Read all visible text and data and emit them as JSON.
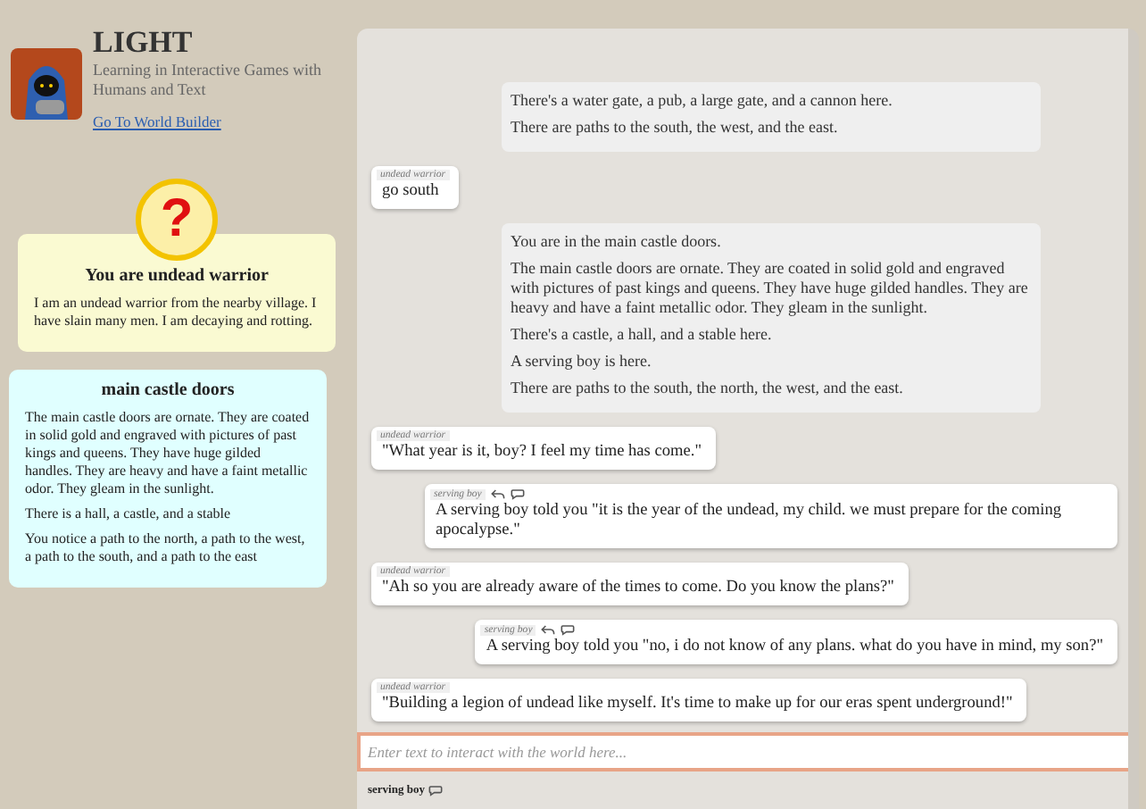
{
  "app": {
    "title": "LIGHT",
    "subtitle": "Learning in Interactive Games with Humans and Text",
    "link": "Go To World Builder"
  },
  "character": {
    "badge": "?",
    "title": "You are undead warrior",
    "description": "I am an undead warrior from the nearby village. I have slain many men. I am decaying and rotting."
  },
  "location": {
    "title": "main castle doors",
    "paragraphs": [
      "The main castle doors are ornate. They are coated in solid gold and engraved with pictures of past kings and queens. They have huge gilded handles. They are heavy and have a faint metallic odor. They gleam in the sunlight.",
      "There is a hall, a castle, and a stable",
      "You notice a path to the north, a path to the west, a path to the south, and a path to the east"
    ]
  },
  "messages": [
    {
      "kind": "room",
      "paragraphs": [
        "There's a water gate, a pub, a large gate, and a cannon here.",
        "There are paths to the south, the west, and the east."
      ]
    },
    {
      "kind": "self",
      "author": "undead warrior",
      "text": "go south"
    },
    {
      "kind": "room",
      "paragraphs": [
        "You are in the main castle doors.",
        "The main castle doors are ornate. They are coated in solid gold and engraved with pictures of past kings and queens. They have huge gilded handles. They are heavy and have a faint metallic odor. They gleam in the sunlight.",
        "There's a castle, a hall, and a stable here.",
        "A serving boy is here.",
        "There are paths to the south, the north, the west, and the east."
      ]
    },
    {
      "kind": "self",
      "author": "undead warrior",
      "text": "\"What year is it, boy? I feel my time has come.\""
    },
    {
      "kind": "other",
      "author": "serving boy",
      "text": "A serving boy told you \"it is the year of the undead, my child. we must prepare for the coming apocalypse.\""
    },
    {
      "kind": "self",
      "author": "undead warrior",
      "text": "\"Ah so you are already aware of the times to come. Do you know the plans?\""
    },
    {
      "kind": "other",
      "author": "serving boy",
      "text": "A serving boy told you \"no, i do not know of any plans. what do you have in mind, my son?\""
    },
    {
      "kind": "self",
      "author": "undead warrior",
      "text": "\"Building a legion of undead like myself. It's time to make up for our eras spent underground!\""
    }
  ],
  "input": {
    "placeholder": "Enter text to interact with the world here..."
  },
  "targets": [
    {
      "label": "serving boy"
    }
  ]
}
